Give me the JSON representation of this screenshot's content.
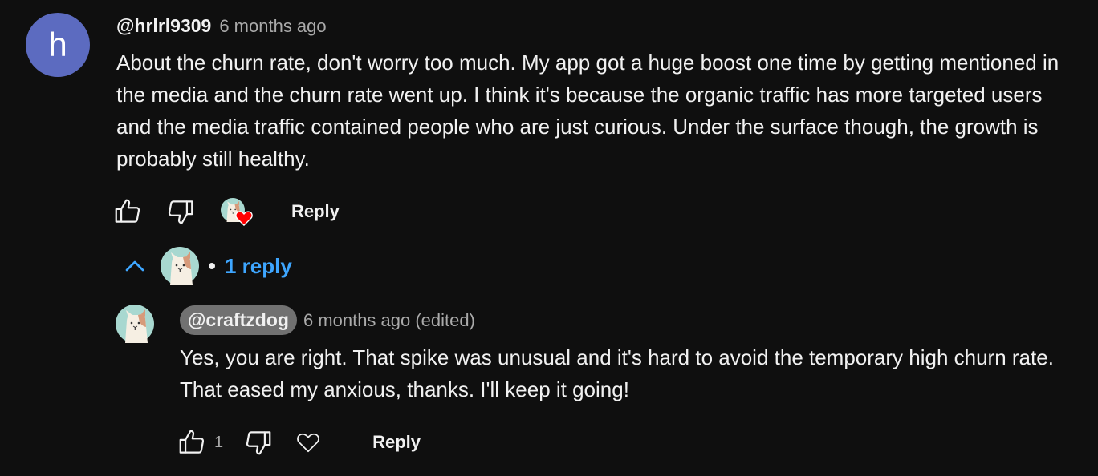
{
  "comment": {
    "avatar_letter": "h",
    "author": "@hrlrl9309",
    "time": "6 months ago",
    "text": "About the churn rate, don't worry too much. My app got a huge boost one time by getting mentioned in the media and the churn rate went up. I think it's because the organic traffic has more targeted users and the media traffic contained people who are just curious. Under the surface though, the growth is probably still healthy.",
    "reply_label": "Reply",
    "icons": [
      "thumbs-up-icon",
      "thumbs-down-icon",
      "creator-heart-icon"
    ]
  },
  "replies_toggle": {
    "label": "1 reply",
    "icons": [
      "chevron-up-icon",
      "avatar"
    ]
  },
  "reply": {
    "author": "@craftzdog",
    "time": "6 months ago (edited)",
    "text": "Yes, you are right. That spike was unusual and it's hard to avoid the temporary high churn rate. That eased my anxious, thanks. I'll keep it going!",
    "like_count": "1",
    "reply_label": "Reply",
    "icons": [
      "thumbs-up-icon",
      "thumbs-down-icon",
      "heart-icon"
    ]
  },
  "colors": {
    "background": "#0f0f0f",
    "text": "#f1f1f1",
    "muted": "#aaaaaa",
    "link": "#3ea6ff",
    "avatar": "#5c6bc0",
    "heart": "#ff0000",
    "author_chip": "#717171"
  }
}
